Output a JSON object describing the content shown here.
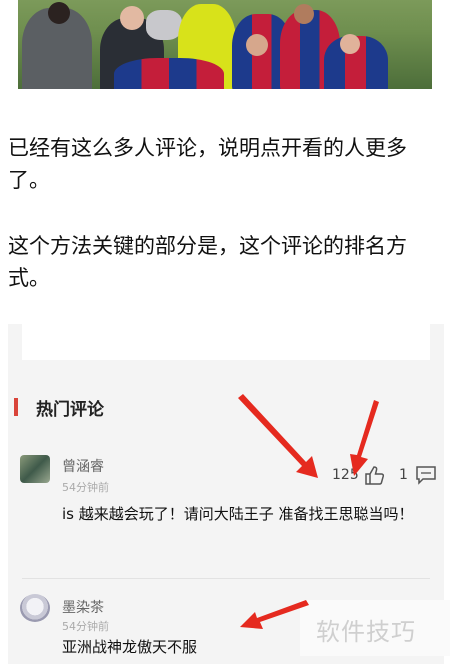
{
  "article": {
    "para1": "已经有这么多人评论，说明点开看的人更多了。",
    "para2": "这个方法关键的部分是，这个评论的排名方式。"
  },
  "comments_section": {
    "title": "热门评论",
    "accent_color": "#d9443a",
    "comments": [
      {
        "user": "曾涵睿",
        "time": "54分钟前",
        "text": "is 越来越会玩了！请问大陆王子 准备找王思聪当吗！",
        "likes": "125",
        "replies": "1"
      },
      {
        "user": "墨染茶",
        "time": "54分钟前",
        "text": "亚洲战神龙傲天不服"
      }
    ]
  },
  "watermark": "软件技巧"
}
